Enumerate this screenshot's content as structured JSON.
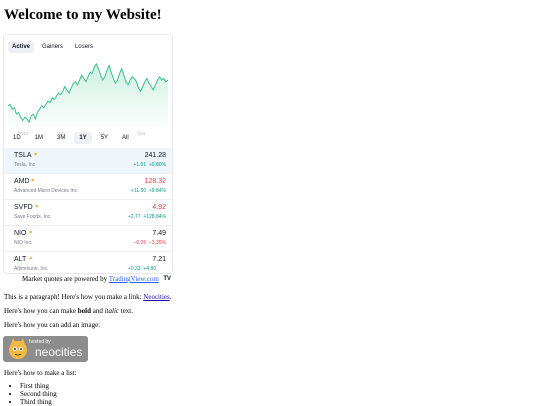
{
  "page": {
    "title": "Welcome to my Website!"
  },
  "widget": {
    "tabs": [
      {
        "label": "Active",
        "active": true
      },
      {
        "label": "Gainers",
        "active": false
      },
      {
        "label": "Losers",
        "active": false
      }
    ],
    "chart": {
      "color": "#3cbf8a",
      "x_labels": [
        "2023",
        "Apr",
        "Jul",
        "Oct"
      ],
      "series": [
        38,
        39,
        36,
        37,
        33,
        34,
        31,
        29,
        31,
        30,
        28,
        32,
        33,
        30,
        34,
        36,
        38,
        37,
        39,
        41,
        40,
        43,
        42,
        44,
        46,
        45,
        47,
        50,
        48,
        46,
        49,
        52,
        53,
        51,
        54,
        57,
        55,
        53,
        56,
        59,
        58,
        62,
        64,
        61,
        57,
        54,
        56,
        60,
        63,
        59,
        55,
        52,
        54,
        58,
        61,
        57,
        53,
        51,
        54,
        56,
        55,
        53,
        49,
        47,
        50,
        53,
        55,
        52,
        50,
        48,
        51,
        54,
        56,
        54,
        55,
        53,
        54
      ]
    },
    "ranges": [
      {
        "label": "1D",
        "active": false
      },
      {
        "label": "1M",
        "active": false
      },
      {
        "label": "3M",
        "active": false
      },
      {
        "label": "1Y",
        "active": true
      },
      {
        "label": "5Y",
        "active": false
      },
      {
        "label": "All",
        "active": false
      }
    ],
    "quotes": [
      {
        "symbol": "TSLA",
        "name": "Tesla, Inc.",
        "price": "241.28",
        "change": "+1.91",
        "percent": "+0.80%",
        "direction": "up",
        "selected": true
      },
      {
        "symbol": "AMD",
        "name": "Advanced Micro Devices Inc",
        "price": "128.32",
        "change": "+11.50",
        "percent": "+9.84%",
        "direction": "up",
        "price_red": true
      },
      {
        "symbol": "SVFD",
        "name": "Save Foods, Inc.",
        "price": "4.92",
        "change": "+2.77",
        "percent": "+128.84%",
        "direction": "up",
        "price_red": true
      },
      {
        "symbol": "NIO",
        "name": "NIO Inc.",
        "price": "7.49",
        "change": "−0.26",
        "percent": "−3.35%",
        "direction": "down"
      },
      {
        "symbol": "ALT",
        "name": "Altimmune, Inc.",
        "price": "7.21",
        "change": "+0.33",
        "percent": "+4.80",
        "direction": "up"
      }
    ],
    "logo": "TV"
  },
  "powered": {
    "prefix": "Market quotes are powered by ",
    "link": "TradingView.com"
  },
  "paragraph": {
    "text": "This is a paragraph! Here's how you make a link: ",
    "link": "Neocities",
    "suffix": "."
  },
  "format_line": {
    "prefix": "Here's how you can make ",
    "bold": "bold",
    "middle": " and ",
    "italic": "italic",
    "suffix": " text."
  },
  "image_line": "Here's how you can add an image:",
  "badge": {
    "small": "hosted by",
    "big": "neocities"
  },
  "list_intro": "Here's how to make a list:",
  "list_items": [
    "First thing",
    "Second thing",
    "Third thing"
  ]
}
